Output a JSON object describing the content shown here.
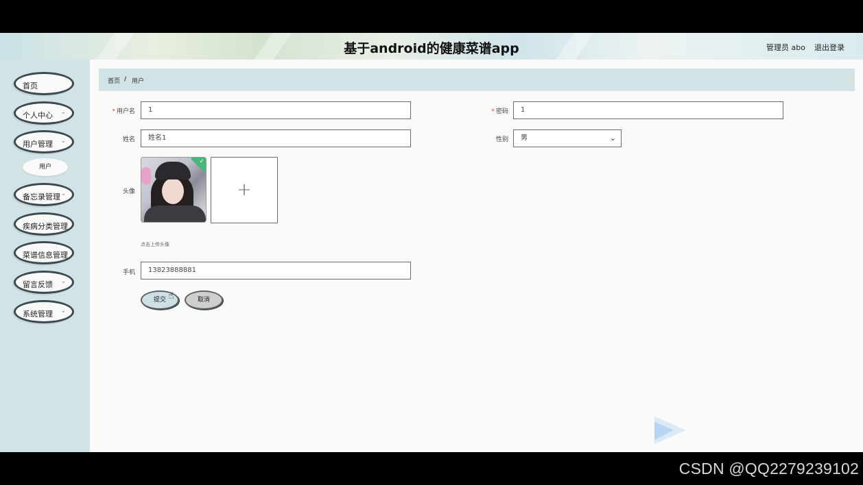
{
  "watermark": "CSDN @QQ2279239102",
  "header": {
    "title": "基于android的健康菜谱app",
    "admin_label": "管理员 abo",
    "logout": "退出登录"
  },
  "sidebar": {
    "items": [
      {
        "label": "首页",
        "has_children": false
      },
      {
        "label": "个人中心",
        "has_children": true
      },
      {
        "label": "用户管理",
        "has_children": true
      },
      {
        "label": "备忘录管理",
        "has_children": true
      },
      {
        "label": "疾病分类管理",
        "has_children": false
      },
      {
        "label": "菜谱信息管理",
        "has_children": false
      },
      {
        "label": "留言反馈",
        "has_children": true
      },
      {
        "label": "系统管理",
        "has_children": true
      }
    ],
    "sub_item": "用户",
    "chevron": "⌄"
  },
  "breadcrumb": {
    "home": "首页",
    "separator": "/",
    "current": "用户"
  },
  "form": {
    "username": {
      "label": "用户名",
      "required": "*",
      "value": "1"
    },
    "password": {
      "label": "密码",
      "required": "*",
      "value": "1"
    },
    "name": {
      "label": "姓名",
      "value": "姓名1"
    },
    "gender": {
      "label": "性别",
      "value": "男"
    },
    "avatar": {
      "label": "头像",
      "hint": "点击上传头像",
      "upload_icon": "+"
    },
    "phone": {
      "label": "手机",
      "value": "13823888881"
    },
    "submit": "提交",
    "cancel": "取消"
  },
  "colors": {
    "sidebar_bg": "#d2e3e6",
    "main_bg": "#fafaf8",
    "required": "#e04040",
    "check_badge": "#45b87a"
  }
}
